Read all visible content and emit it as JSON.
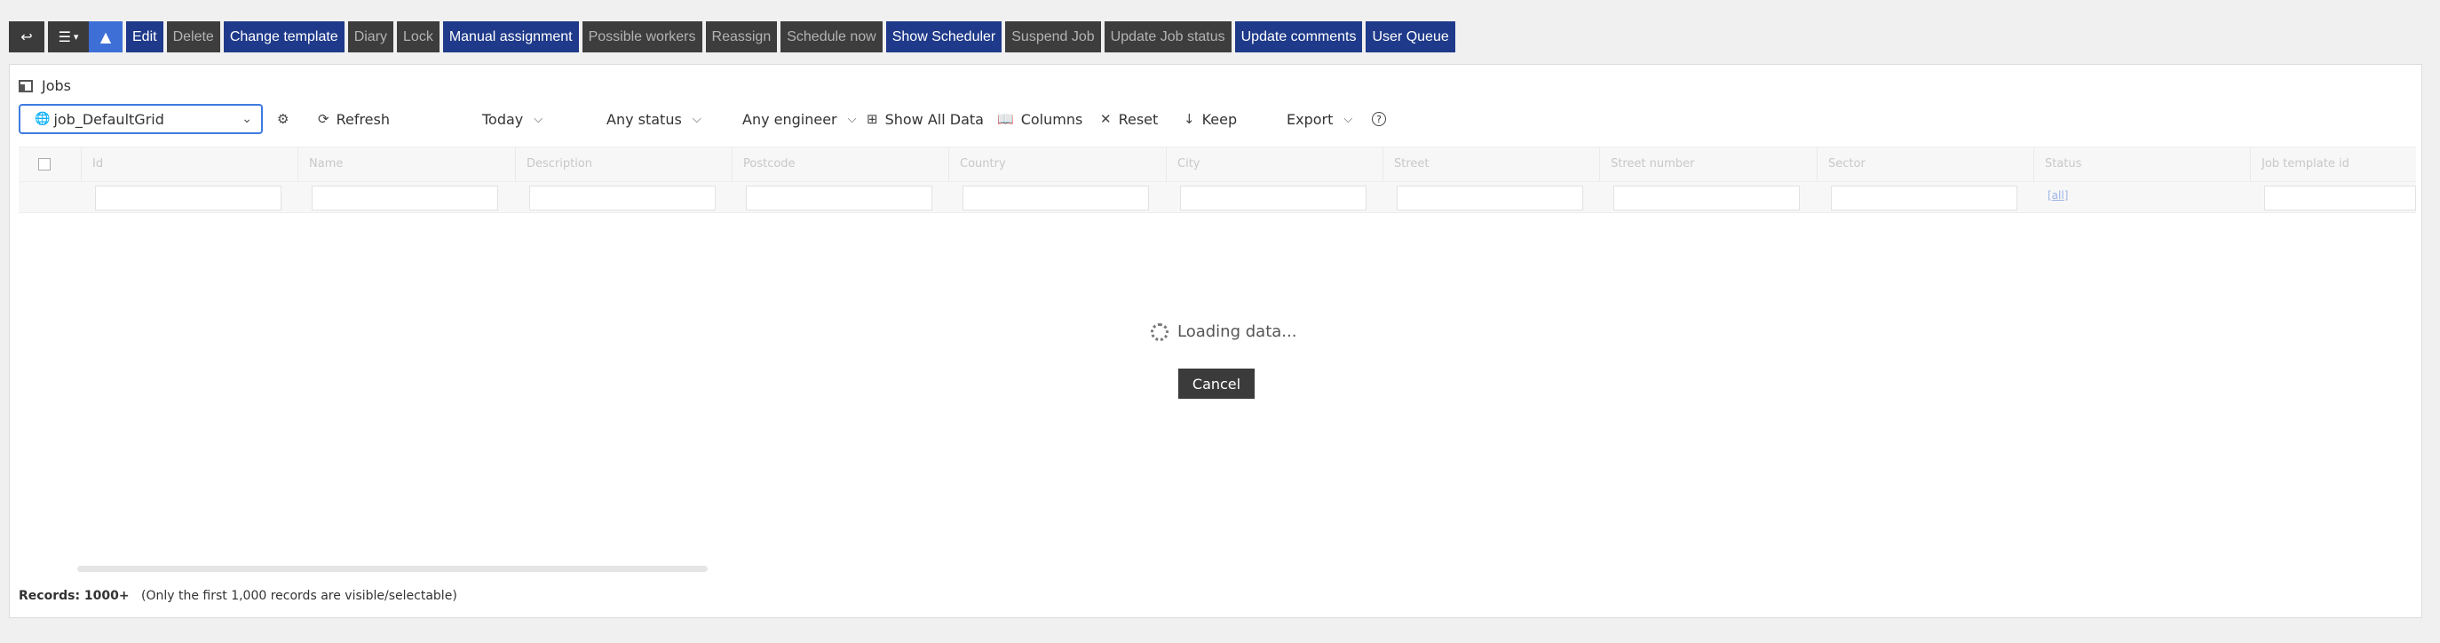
{
  "toolbar": {
    "buttons": {
      "edit": "Edit",
      "delete": "Delete",
      "change_template": "Change template",
      "diary": "Diary",
      "lock": "Lock",
      "manual_assignment": "Manual assignment",
      "possible_workers": "Possible workers",
      "reassign": "Reassign",
      "schedule_now": "Schedule now",
      "show_scheduler": "Show Scheduler",
      "suspend_job": "Suspend Job",
      "update_job_status": "Update Job status",
      "update_comments": "Update comments",
      "user_queue": "User Queue"
    },
    "colors": {
      "enabled": "#1f3a8a",
      "disabled": "#3d3d3d",
      "accent": "#3d6fd6"
    }
  },
  "panel": {
    "title": "Jobs",
    "view_select": "job_DefaultGrid",
    "refresh": "Refresh",
    "date_filter": "Today",
    "status_filter": "Any status",
    "engineer_filter": "Any engineer",
    "show_all": "Show All Data",
    "columns": "Columns",
    "reset": "Reset",
    "keep": "Keep",
    "export": "Export",
    "help": "?"
  },
  "grid": {
    "columns": [
      "Id",
      "Name",
      "Description",
      "Postcode",
      "Country",
      "City",
      "Street",
      "Street number",
      "Sector",
      "Status",
      "Job template id"
    ],
    "status_filter_link": "[all]"
  },
  "loading": {
    "text": "Loading data...",
    "cancel": "Cancel"
  },
  "footer": {
    "records_label": "Records: 1000+",
    "records_note": "(Only the first 1,000 records are visible/selectable)"
  }
}
